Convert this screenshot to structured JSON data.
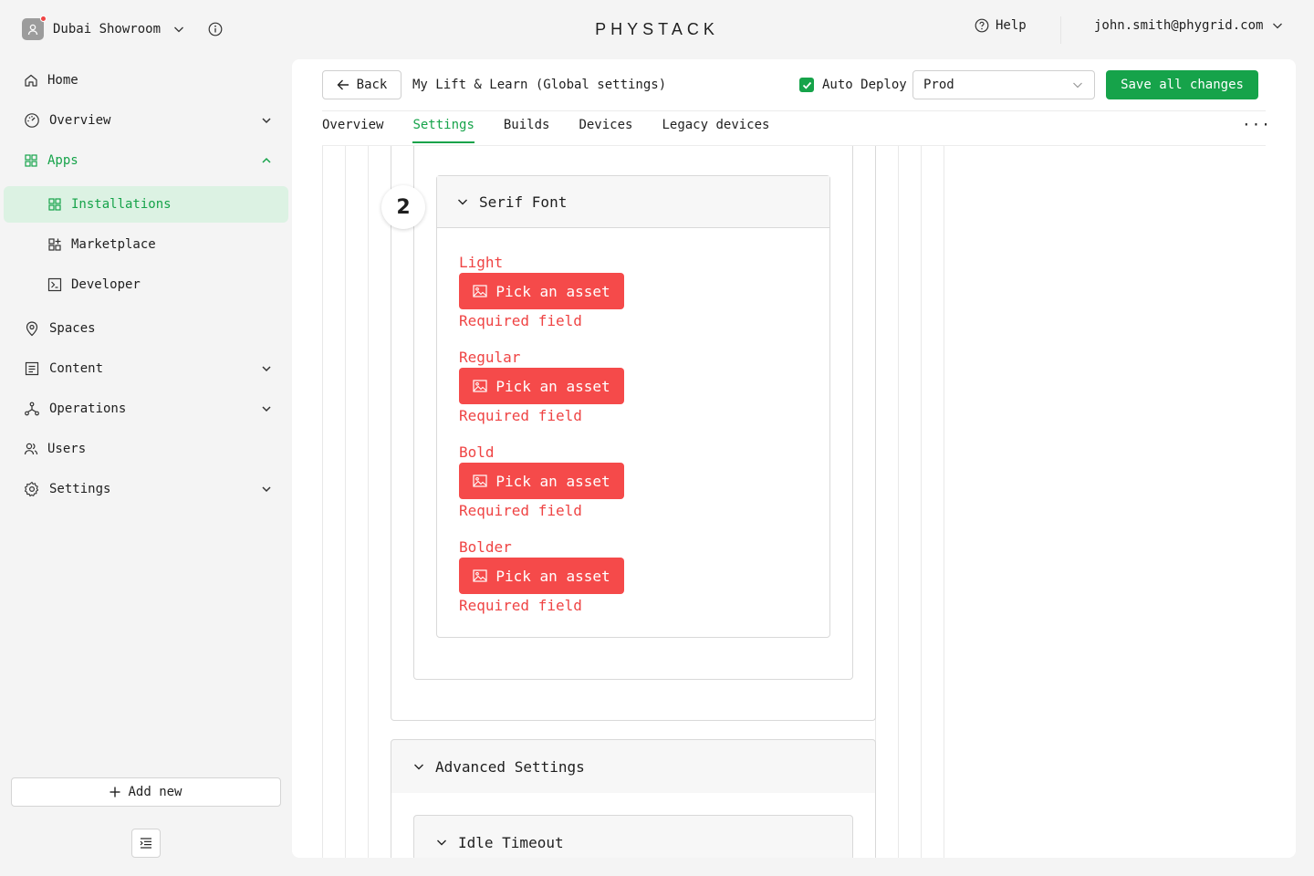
{
  "workspace": {
    "name": "Dubai Showroom"
  },
  "brand": {
    "logo_text": "PHYSTACK"
  },
  "topbar": {
    "help_label": "Help",
    "user_email": "john.smith@phygrid.com"
  },
  "sidebar": {
    "items": [
      {
        "label": "Home",
        "icon": "home-icon"
      },
      {
        "label": "Overview",
        "icon": "gauge-icon",
        "expandable": true
      },
      {
        "label": "Apps",
        "icon": "apps-grid-icon",
        "expanded": true
      },
      {
        "label": "Spaces",
        "icon": "map-pin-icon"
      },
      {
        "label": "Content",
        "icon": "content-list-icon",
        "expandable": true
      },
      {
        "label": "Operations",
        "icon": "network-icon",
        "expandable": true
      },
      {
        "label": "Users",
        "icon": "users-icon"
      },
      {
        "label": "Settings",
        "icon": "gear-icon",
        "expandable": true
      }
    ],
    "apps_children": [
      {
        "label": "Installations",
        "icon": "grid-icon",
        "active": true
      },
      {
        "label": "Marketplace",
        "icon": "grid-plus-icon"
      },
      {
        "label": "Developer",
        "icon": "terminal-icon"
      }
    ],
    "add_new_label": "Add new"
  },
  "header": {
    "back_label": "Back",
    "title": "My Lift & Learn (Global settings)",
    "auto_deploy_label": "Auto Deploy",
    "auto_deploy_checked": true,
    "environment": "Prod",
    "save_label": "Save all changes"
  },
  "tabs": [
    {
      "label": "Overview",
      "active": false
    },
    {
      "label": "Settings",
      "active": true
    },
    {
      "label": "Builds",
      "active": false
    },
    {
      "label": "Devices",
      "active": false
    },
    {
      "label": "Legacy devices",
      "active": false
    }
  ],
  "more_label": "···",
  "serif_font": {
    "step_number": "2",
    "title": "Serif Font",
    "fields": [
      {
        "label": "Light",
        "button": "Pick an asset",
        "error": "Required field"
      },
      {
        "label": "Regular",
        "button": "Pick an asset",
        "error": "Required field"
      },
      {
        "label": "Bold",
        "button": "Pick an asset",
        "error": "Required field"
      },
      {
        "label": "Bolder",
        "button": "Pick an asset",
        "error": "Required field"
      }
    ]
  },
  "advanced": {
    "title": "Advanced Settings"
  },
  "idle": {
    "title": "Idle Timeout"
  },
  "colors": {
    "accent": "#16a34a",
    "error": "#ef4444",
    "pick_button": "#f54a4a",
    "active_bg": "#dcf2e3"
  }
}
